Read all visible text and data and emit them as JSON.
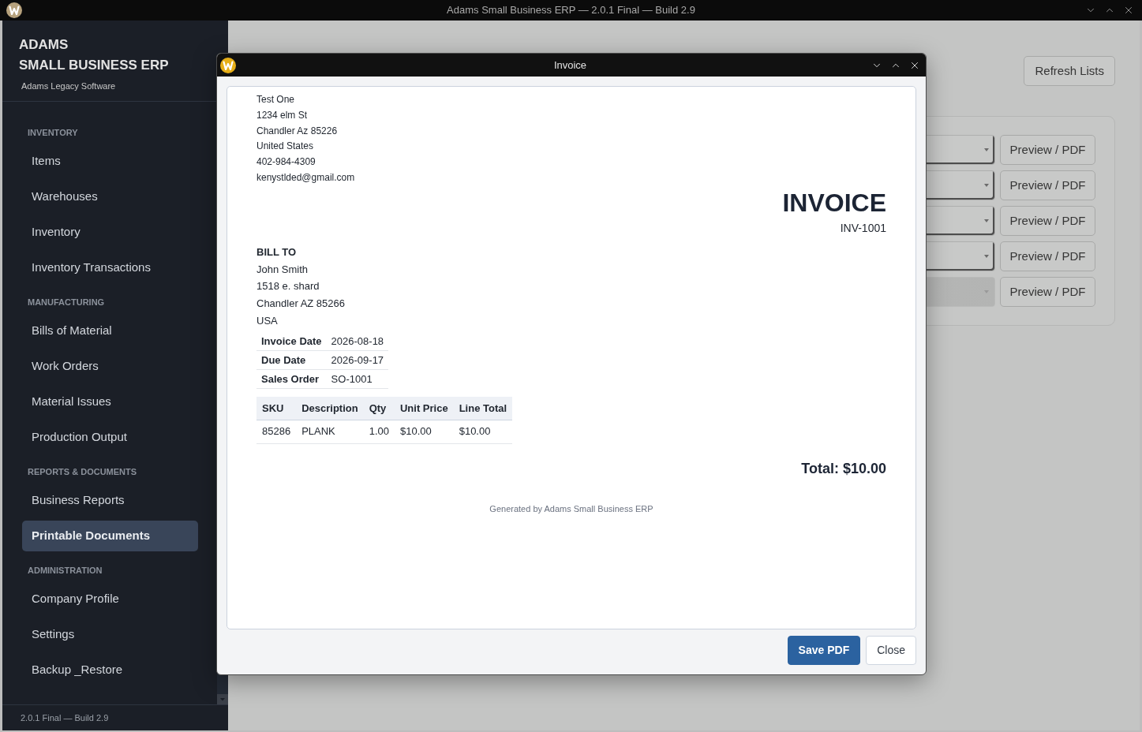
{
  "window": {
    "title": "Adams Small Business ERP — 2.0.1 Final — Build 2.9"
  },
  "sidebar": {
    "brand_line_1": "ADAMS",
    "brand_line_2": "SMALL BUSINESS ERP",
    "tagline": "Adams Legacy Software",
    "sections": [
      {
        "heading": "INVENTORY",
        "items": [
          {
            "label": "Items",
            "selected": false
          },
          {
            "label": "Warehouses",
            "selected": false
          },
          {
            "label": "Inventory",
            "selected": false
          },
          {
            "label": "Inventory Transactions",
            "selected": false
          }
        ]
      },
      {
        "heading": "MANUFACTURING",
        "items": [
          {
            "label": "Bills of Material",
            "selected": false
          },
          {
            "label": "Work Orders",
            "selected": false
          },
          {
            "label": "Material Issues",
            "selected": false
          },
          {
            "label": "Production Output",
            "selected": false
          }
        ]
      },
      {
        "heading": "REPORTS & DOCUMENTS",
        "items": [
          {
            "label": "Business Reports",
            "selected": false
          },
          {
            "label": "Printable Documents",
            "selected": true
          }
        ]
      },
      {
        "heading": "ADMINISTRATION",
        "items": [
          {
            "label": "Company Profile",
            "selected": false
          },
          {
            "label": "Settings",
            "selected": false
          },
          {
            "label": "Backup _Restore",
            "selected": false
          }
        ]
      }
    ],
    "footer": "2.0.1 Final — Build 2.9"
  },
  "main": {
    "refresh_button": "Refresh Lists",
    "document_rows": [
      {
        "disabled": false,
        "button": "Preview / PDF"
      },
      {
        "disabled": false,
        "button": "Preview / PDF"
      },
      {
        "disabled": false,
        "button": "Preview / PDF"
      },
      {
        "disabled": false,
        "button": "Preview / PDF"
      },
      {
        "disabled": true,
        "button": "Preview / PDF"
      }
    ]
  },
  "dialog": {
    "title": "Invoice",
    "company_lines": [
      "Test One",
      "1234 elm St",
      "Chandler Az 85226",
      "United States",
      "402-984-4309",
      "kenystlded@gmail.com"
    ],
    "document_title": "INVOICE",
    "document_number": "INV-1001",
    "bill_to": {
      "heading": "BILL TO",
      "lines": [
        "John Smith",
        "1518 e. shard",
        "Chandler AZ 85266",
        "USA"
      ]
    },
    "meta": [
      {
        "label": "Invoice Date",
        "value": "2026-08-18"
      },
      {
        "label": "Due Date",
        "value": "2026-09-17"
      },
      {
        "label": "Sales Order",
        "value": "SO-1001"
      }
    ],
    "items_table": {
      "columns": [
        "SKU",
        "Description",
        "Qty",
        "Unit Price",
        "Line Total"
      ],
      "rows": [
        [
          "85286",
          "PLANK",
          "1.00",
          "$10.00",
          "$10.00"
        ]
      ]
    },
    "total": "Total: $10.00",
    "footer_note": "Generated by Adams Small Business ERP",
    "buttons": [
      {
        "label": "Save PDF",
        "kind": "primary"
      },
      {
        "label": "Close",
        "kind": "secondary"
      }
    ]
  }
}
